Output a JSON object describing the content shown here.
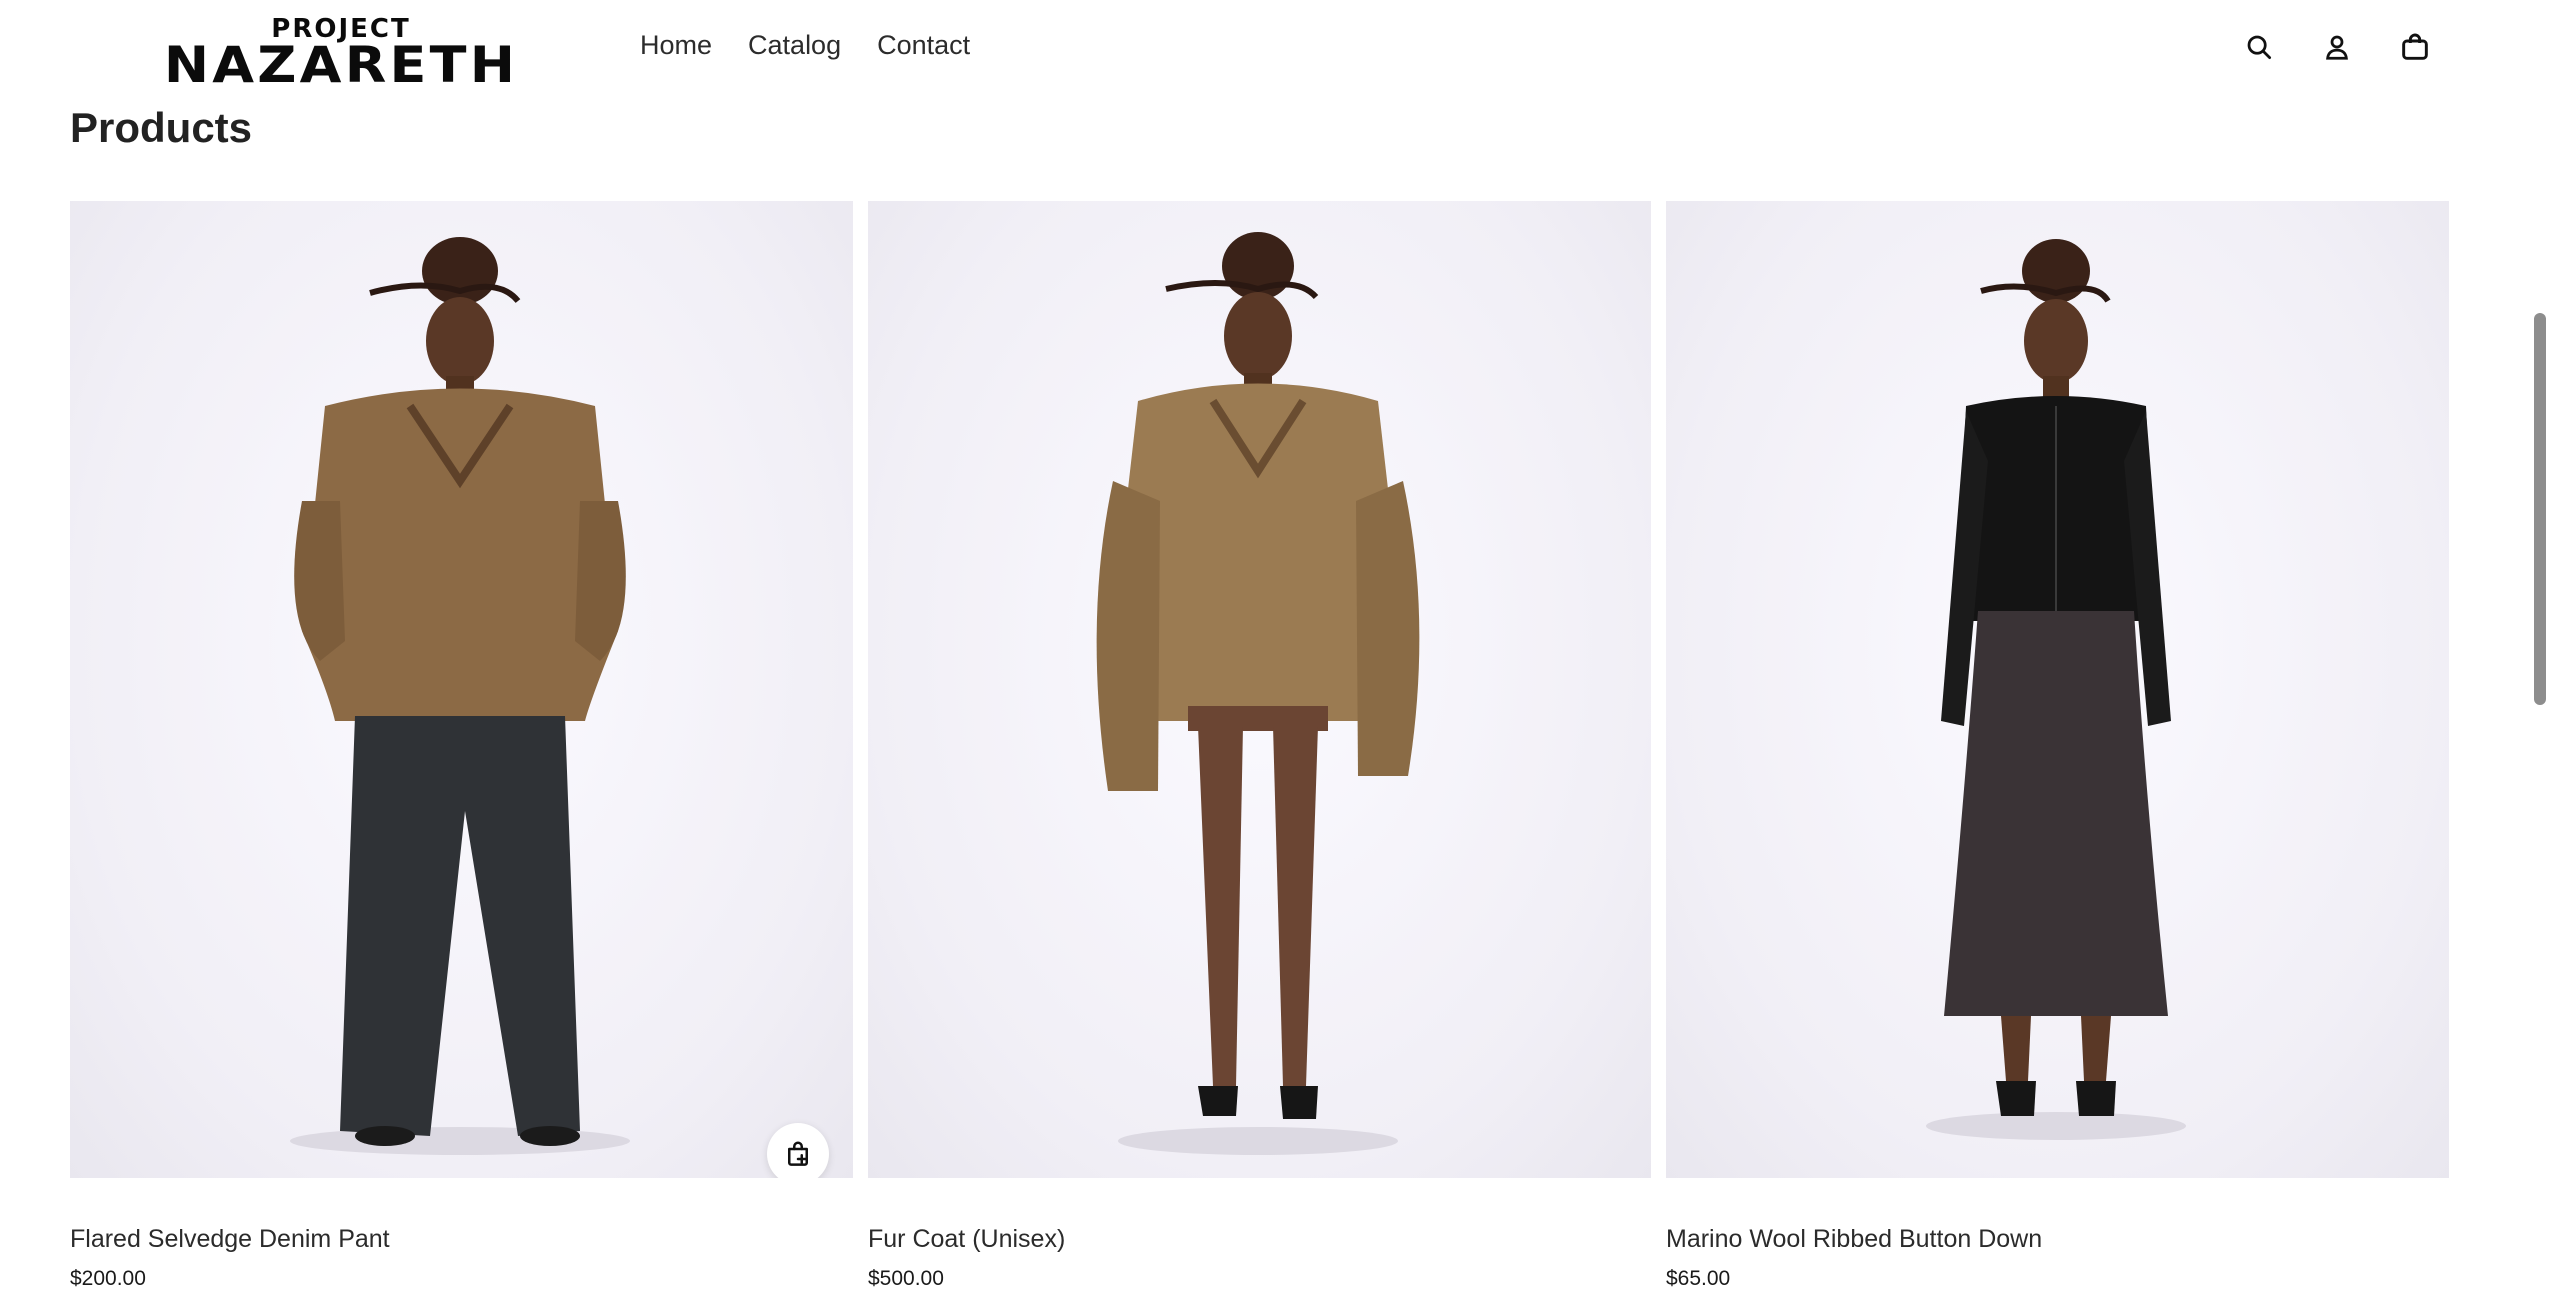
{
  "brand": {
    "logo_top": "PROJECT",
    "logo_main": "NAZARETH"
  },
  "nav": {
    "items": [
      "Home",
      "Catalog",
      "Contact"
    ]
  },
  "header_icons": [
    "search-icon",
    "account-icon",
    "cart-icon"
  ],
  "section": {
    "title": "Products"
  },
  "products": [
    {
      "title": "Flared Selvedge Denim Pant",
      "price": "$200.00",
      "top_color": "#8c6a45",
      "bottom_color": "#2f3236",
      "quick_add_icon": "bag-plus-icon"
    },
    {
      "title": "Fur Coat (Unisex)",
      "price": "$500.00",
      "top_color": "#9b7b52",
      "bottom_color": "#6b4533"
    },
    {
      "title": "Marino Wool Ribbed Button Down",
      "price": "$65.00",
      "top_color": "#141414",
      "bottom_color": "#3a3336"
    }
  ]
}
